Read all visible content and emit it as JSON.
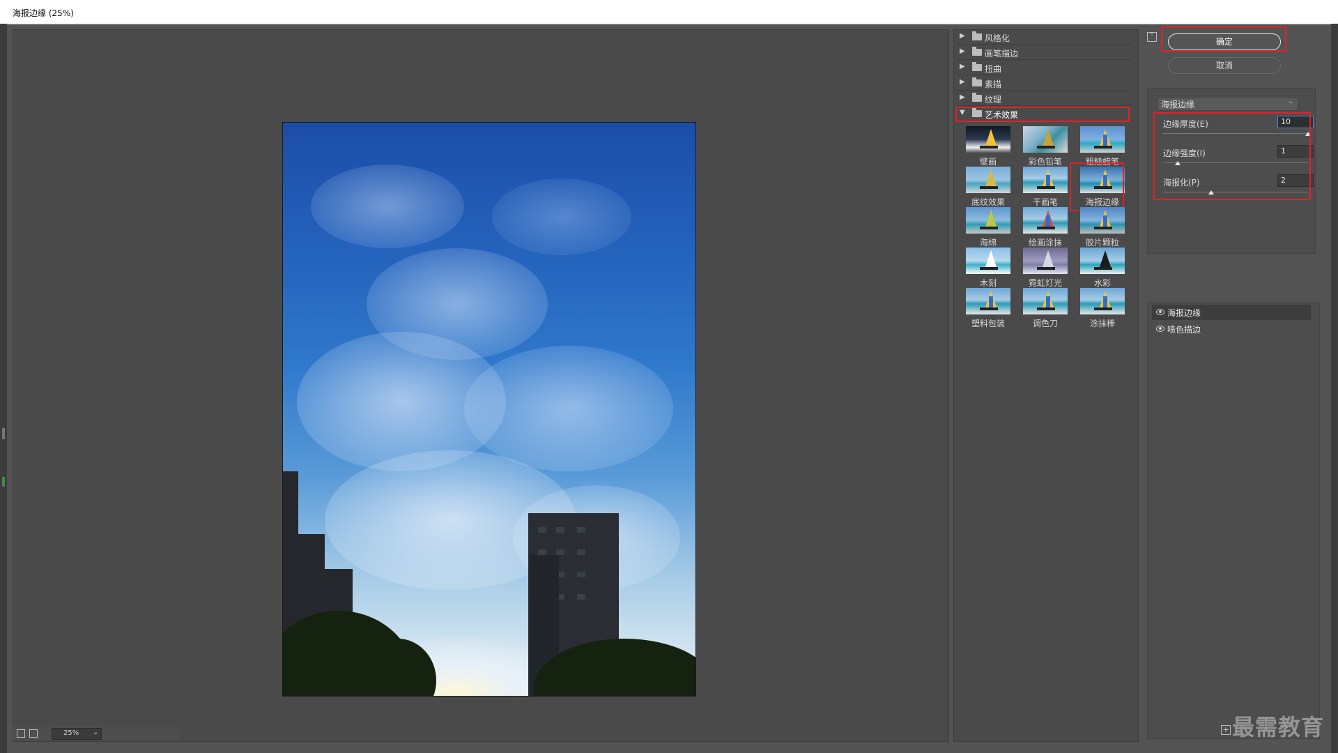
{
  "window": {
    "title": "海报边缘 (25%)"
  },
  "gallery": {
    "categories": [
      {
        "label": "风格化",
        "expanded": false
      },
      {
        "label": "画笔描边",
        "expanded": false
      },
      {
        "label": "扭曲",
        "expanded": false
      },
      {
        "label": "素描",
        "expanded": false
      },
      {
        "label": "纹理",
        "expanded": false
      },
      {
        "label": "艺术效果",
        "expanded": true
      }
    ],
    "filters": [
      {
        "label": "壁画"
      },
      {
        "label": "彩色铅笔"
      },
      {
        "label": "粗糙蜡笔"
      },
      {
        "label": "底纹效果"
      },
      {
        "label": "干画笔"
      },
      {
        "label": "海报边缘"
      },
      {
        "label": "海绵"
      },
      {
        "label": "绘画涂抹"
      },
      {
        "label": "胶片颗粒"
      },
      {
        "label": "木刻"
      },
      {
        "label": "霓虹灯光"
      },
      {
        "label": "水彩"
      },
      {
        "label": "塑料包装"
      },
      {
        "label": "调色刀"
      },
      {
        "label": "涂抹棒"
      }
    ],
    "selected_filter": "海报边缘"
  },
  "controls": {
    "ok_label": "确定",
    "cancel_label": "取消",
    "filter_select": "海报边缘",
    "params": [
      {
        "label": "边缘厚度(E)",
        "value": "10",
        "level": 1.0
      },
      {
        "label": "边缘强度(I)",
        "value": "1",
        "level": 0.1
      },
      {
        "label": "海报化(P)",
        "value": "2",
        "level": 0.33
      }
    ]
  },
  "layers": [
    {
      "name": "海报边缘",
      "visible": true,
      "selected": true
    },
    {
      "name": "喷色描边",
      "visible": true,
      "selected": false
    }
  ],
  "statusbar": {
    "zoom": "25%"
  },
  "watermark": "最需教育",
  "colors": {
    "highlight": "#e0222a",
    "panel": "#4a4a4a",
    "background": "#535353"
  }
}
